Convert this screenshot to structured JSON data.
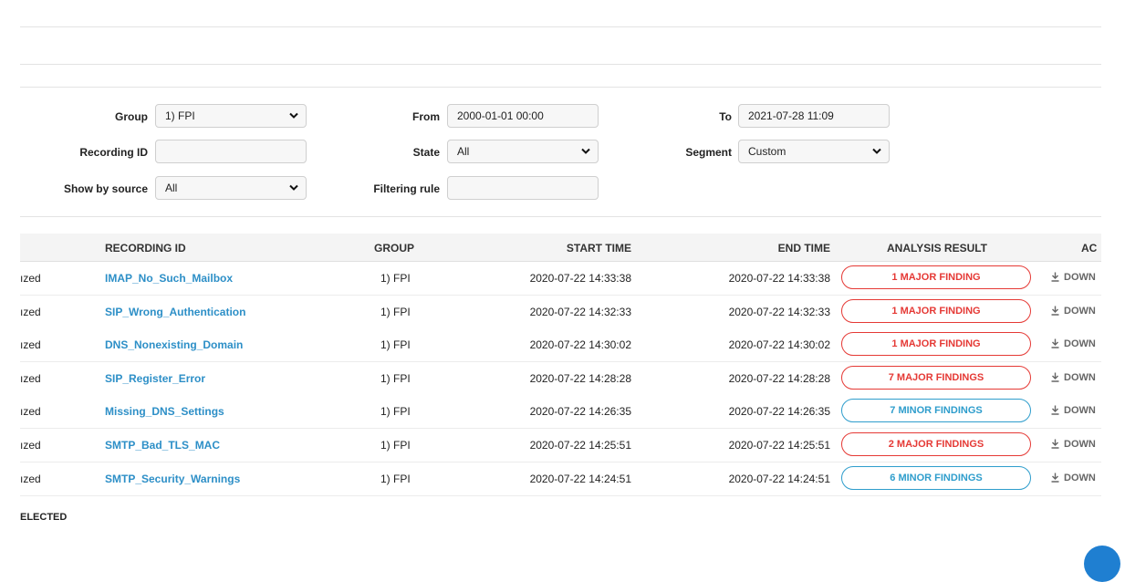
{
  "filters": {
    "group": {
      "label": "Group",
      "value": "1) FPI"
    },
    "recording_id": {
      "label": "Recording ID",
      "value": ""
    },
    "show_by_source": {
      "label": "Show by source",
      "value": "All"
    },
    "from": {
      "label": "From",
      "value": "2000-01-01 00:00"
    },
    "state": {
      "label": "State",
      "value": "All"
    },
    "filtering_rule": {
      "label": "Filtering rule",
      "value": ""
    },
    "to": {
      "label": "To",
      "value": "2021-07-28 11:09"
    },
    "segment": {
      "label": "Segment",
      "value": "Custom"
    }
  },
  "table": {
    "headers": {
      "recording_id": "RECORDING ID",
      "group": "GROUP",
      "start_time": "START TIME",
      "end_time": "END TIME",
      "analysis_result": "ANALYSIS RESULT",
      "actions": "AC"
    },
    "rows": [
      {
        "status": "ızed",
        "recording_id": "IMAP_No_Such_Mailbox",
        "group": "1) FPI",
        "start_time": "2020-07-22 14:33:38",
        "end_time": "2020-07-22 14:33:38",
        "result": "1 MAJOR FINDING",
        "severity": "major",
        "action": "DOWN"
      },
      {
        "status": "ızed",
        "recording_id": "SIP_Wrong_Authentication",
        "group": "1) FPI",
        "start_time": "2020-07-22 14:32:33",
        "end_time": "2020-07-22 14:32:33",
        "result": "1 MAJOR FINDING",
        "severity": "major",
        "action": "DOWN"
      },
      {
        "status": "ızed",
        "recording_id": "DNS_Nonexisting_Domain",
        "group": "1) FPI",
        "start_time": "2020-07-22 14:30:02",
        "end_time": "2020-07-22 14:30:02",
        "result": "1 MAJOR FINDING",
        "severity": "major",
        "action": "DOWN"
      },
      {
        "status": "ızed",
        "recording_id": "SIP_Register_Error",
        "group": "1) FPI",
        "start_time": "2020-07-22 14:28:28",
        "end_time": "2020-07-22 14:28:28",
        "result": "7 MAJOR FINDINGS",
        "severity": "major",
        "action": "DOWN"
      },
      {
        "status": "ızed",
        "recording_id": "Missing_DNS_Settings",
        "group": "1) FPI",
        "start_time": "2020-07-22 14:26:35",
        "end_time": "2020-07-22 14:26:35",
        "result": "7 MINOR FINDINGS",
        "severity": "minor",
        "action": "DOWN"
      },
      {
        "status": "ızed",
        "recording_id": "SMTP_Bad_TLS_MAC",
        "group": "1) FPI",
        "start_time": "2020-07-22 14:25:51",
        "end_time": "2020-07-22 14:25:51",
        "result": "2 MAJOR FINDINGS",
        "severity": "major",
        "action": "DOWN"
      },
      {
        "status": "ızed",
        "recording_id": "SMTP_Security_Warnings",
        "group": "1) FPI",
        "start_time": "2020-07-22 14:24:51",
        "end_time": "2020-07-22 14:24:51",
        "result": "6 MINOR FINDINGS",
        "severity": "minor",
        "action": "DOWN"
      }
    ]
  },
  "footer": {
    "selected_label": "ELECTED"
  },
  "colors": {
    "major": "#e53935",
    "minor": "#2e9dcc",
    "link": "#2d8fc7"
  },
  "icons": {
    "select": "chevron-down-icon",
    "download": "download-icon"
  }
}
